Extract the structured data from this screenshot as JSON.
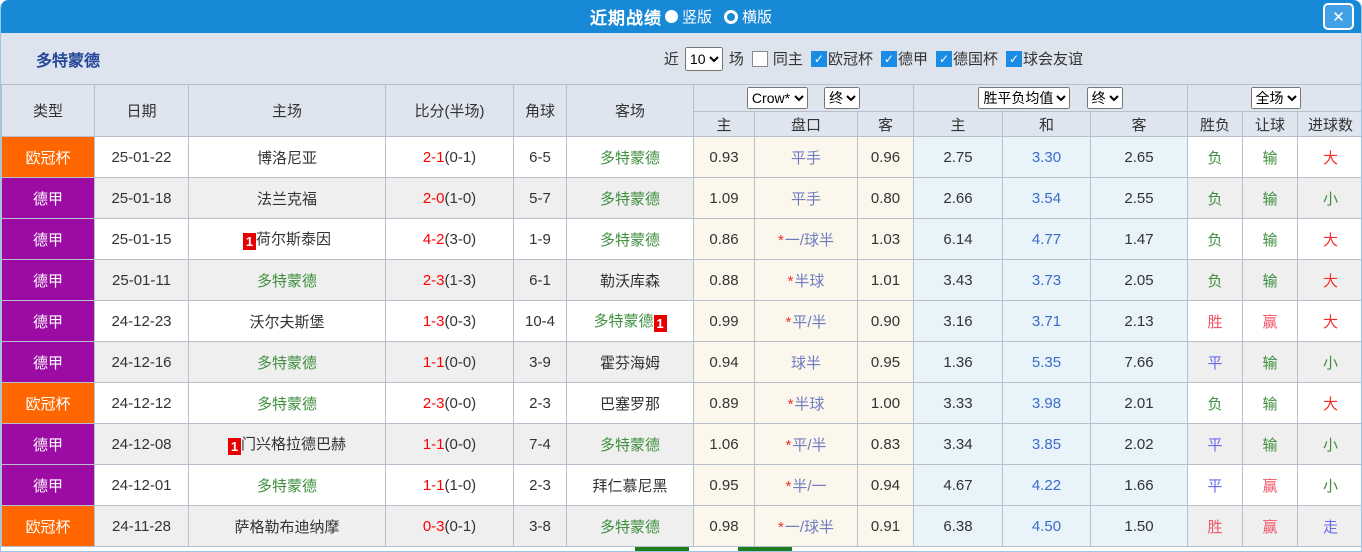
{
  "titlebar": {
    "title": "近期战绩",
    "layout_options": [
      {
        "label": "竖版",
        "selected": true
      },
      {
        "label": "横版",
        "selected": false
      }
    ],
    "close": "✕"
  },
  "filters": {
    "team": "多特蒙德",
    "recent_label": "近",
    "recent_count": "10",
    "matches_label": "场",
    "same_home": {
      "label": "同主",
      "checked": false
    },
    "leagues": [
      {
        "label": "欧冠杯",
        "checked": true
      },
      {
        "label": "德甲",
        "checked": true
      },
      {
        "label": "德国杯",
        "checked": true
      },
      {
        "label": "球会友谊",
        "checked": true
      }
    ]
  },
  "controls": {
    "odds_source": "Crow*",
    "odds_time": "终",
    "wdl_avg": "胜平负均值",
    "wdl_time": "终",
    "scope": "全场"
  },
  "headers": {
    "type": "类型",
    "date": "日期",
    "home": "主场",
    "score": "比分(半场)",
    "corner": "角球",
    "away": "客场",
    "odds_home": "主",
    "handicap": "盘口",
    "odds_away": "客",
    "avg_win": "主",
    "avg_draw": "和",
    "avg_lose": "客",
    "result_wdl": "胜负",
    "result_handicap": "让球",
    "result_goals": "进球数"
  },
  "rows": [
    {
      "type": "欧冠杯",
      "type_color": "orange",
      "date": "25-01-22",
      "home": "博洛尼亚",
      "home_is_target": false,
      "home_badge": "",
      "score": "2-1",
      "half": "(0-1)",
      "corner": "6-5",
      "away": "多特蒙德",
      "away_is_target": true,
      "away_badge": "",
      "odds_home": "0.93",
      "handicap_star": false,
      "handicap": "平手",
      "odds_away": "0.96",
      "avg_win": "2.75",
      "avg_draw": "3.30",
      "avg_lose": "2.65",
      "result_wdl": "负",
      "result_wdl_color": "green",
      "result_handicap": "输",
      "result_handicap_color": "green",
      "result_goals": "大",
      "result_goals_color": "red"
    },
    {
      "type": "德甲",
      "type_color": "purple",
      "date": "25-01-18",
      "home": "法兰克福",
      "home_is_target": false,
      "home_badge": "",
      "score": "2-0",
      "half": "(1-0)",
      "corner": "5-7",
      "away": "多特蒙德",
      "away_is_target": true,
      "away_badge": "",
      "odds_home": "1.09",
      "handicap_star": false,
      "handicap": "平手",
      "odds_away": "0.80",
      "avg_win": "2.66",
      "avg_draw": "3.54",
      "avg_lose": "2.55",
      "result_wdl": "负",
      "result_wdl_color": "green",
      "result_handicap": "输",
      "result_handicap_color": "green",
      "result_goals": "小",
      "result_goals_color": "green"
    },
    {
      "type": "德甲",
      "type_color": "purple",
      "date": "25-01-15",
      "home": "荷尔斯泰因",
      "home_is_target": false,
      "home_badge": "1",
      "score": "4-2",
      "half": "(3-0)",
      "corner": "1-9",
      "away": "多特蒙德",
      "away_is_target": true,
      "away_badge": "",
      "odds_home": "0.86",
      "handicap_star": true,
      "handicap": "一/球半",
      "odds_away": "1.03",
      "avg_win": "6.14",
      "avg_draw": "4.77",
      "avg_lose": "1.47",
      "result_wdl": "负",
      "result_wdl_color": "green",
      "result_handicap": "输",
      "result_handicap_color": "green",
      "result_goals": "大",
      "result_goals_color": "red"
    },
    {
      "type": "德甲",
      "type_color": "purple",
      "date": "25-01-11",
      "home": "多特蒙德",
      "home_is_target": true,
      "home_badge": "",
      "score": "2-3",
      "half": "(1-3)",
      "corner": "6-1",
      "away": "勒沃库森",
      "away_is_target": false,
      "away_badge": "",
      "odds_home": "0.88",
      "handicap_star": true,
      "handicap": "半球",
      "odds_away": "1.01",
      "avg_win": "3.43",
      "avg_draw": "3.73",
      "avg_lose": "2.05",
      "result_wdl": "负",
      "result_wdl_color": "green",
      "result_handicap": "输",
      "result_handicap_color": "green",
      "result_goals": "大",
      "result_goals_color": "red"
    },
    {
      "type": "德甲",
      "type_color": "purple",
      "date": "24-12-23",
      "home": "沃尔夫斯堡",
      "home_is_target": false,
      "home_badge": "",
      "score": "1-3",
      "half": "(0-3)",
      "corner": "10-4",
      "away": "多特蒙德",
      "away_is_target": true,
      "away_badge": "1",
      "odds_home": "0.99",
      "handicap_star": true,
      "handicap": "平/半",
      "odds_away": "0.90",
      "avg_win": "3.16",
      "avg_draw": "3.71",
      "avg_lose": "2.13",
      "result_wdl": "胜",
      "result_wdl_color": "winred",
      "result_handicap": "赢",
      "result_handicap_color": "winred",
      "result_goals": "大",
      "result_goals_color": "red"
    },
    {
      "type": "德甲",
      "type_color": "purple",
      "date": "24-12-16",
      "home": "多特蒙德",
      "home_is_target": true,
      "home_badge": "",
      "score": "1-1",
      "half": "(0-0)",
      "corner": "3-9",
      "away": "霍芬海姆",
      "away_is_target": false,
      "away_badge": "",
      "odds_home": "0.94",
      "handicap_star": false,
      "handicap": "球半",
      "odds_away": "0.95",
      "avg_win": "1.36",
      "avg_draw": "5.35",
      "avg_lose": "7.66",
      "result_wdl": "平",
      "result_wdl_color": "blue",
      "result_handicap": "输",
      "result_handicap_color": "green",
      "result_goals": "小",
      "result_goals_color": "green"
    },
    {
      "type": "欧冠杯",
      "type_color": "orange",
      "date": "24-12-12",
      "home": "多特蒙德",
      "home_is_target": true,
      "home_badge": "",
      "score": "2-3",
      "half": "(0-0)",
      "corner": "2-3",
      "away": "巴塞罗那",
      "away_is_target": false,
      "away_badge": "",
      "odds_home": "0.89",
      "handicap_star": true,
      "handicap": "半球",
      "odds_away": "1.00",
      "avg_win": "3.33",
      "avg_draw": "3.98",
      "avg_lose": "2.01",
      "result_wdl": "负",
      "result_wdl_color": "green",
      "result_handicap": "输",
      "result_handicap_color": "green",
      "result_goals": "大",
      "result_goals_color": "red"
    },
    {
      "type": "德甲",
      "type_color": "purple",
      "date": "24-12-08",
      "home": "门兴格拉德巴赫",
      "home_is_target": false,
      "home_badge": "1",
      "score": "1-1",
      "half": "(0-0)",
      "corner": "7-4",
      "away": "多特蒙德",
      "away_is_target": true,
      "away_badge": "",
      "odds_home": "1.06",
      "handicap_star": true,
      "handicap": "平/半",
      "odds_away": "0.83",
      "avg_win": "3.34",
      "avg_draw": "3.85",
      "avg_lose": "2.02",
      "result_wdl": "平",
      "result_wdl_color": "blue",
      "result_handicap": "输",
      "result_handicap_color": "green",
      "result_goals": "小",
      "result_goals_color": "green"
    },
    {
      "type": "德甲",
      "type_color": "purple",
      "date": "24-12-01",
      "home": "多特蒙德",
      "home_is_target": true,
      "home_badge": "",
      "score": "1-1",
      "half": "(1-0)",
      "corner": "2-3",
      "away": "拜仁慕尼黑",
      "away_is_target": false,
      "away_badge": "",
      "odds_home": "0.95",
      "handicap_star": true,
      "handicap": "半/一",
      "odds_away": "0.94",
      "avg_win": "4.67",
      "avg_draw": "4.22",
      "avg_lose": "1.66",
      "result_wdl": "平",
      "result_wdl_color": "blue",
      "result_handicap": "赢",
      "result_handicap_color": "winred",
      "result_goals": "小",
      "result_goals_color": "green"
    },
    {
      "type": "欧冠杯",
      "type_color": "orange",
      "date": "24-11-28",
      "home": "萨格勒布迪纳摩",
      "home_is_target": false,
      "home_badge": "",
      "score": "0-3",
      "half": "(0-1)",
      "corner": "3-8",
      "away": "多特蒙德",
      "away_is_target": true,
      "away_badge": "",
      "odds_home": "0.98",
      "handicap_star": true,
      "handicap": "一/球半",
      "odds_away": "0.91",
      "avg_win": "6.38",
      "avg_draw": "4.50",
      "avg_lose": "1.50",
      "result_wdl": "胜",
      "result_wdl_color": "winred",
      "result_handicap": "赢",
      "result_handicap_color": "winred",
      "result_goals": "走",
      "result_goals_color": "blue"
    }
  ],
  "colors": {
    "accent_blue": "#1789d6",
    "type_orange": "#ff6600",
    "type_purple": "#9c0ba4",
    "target_team_green": "#3f8f3f",
    "score_red": "#ff0000",
    "draw_odds_blue": "#3a6cc8",
    "handicap_blue": "#6e7cc0",
    "win_red": "#f0556a",
    "lose_green": "#3f8f3f",
    "neutral_blue": "#6a6af0",
    "big_red": "#f12e2e",
    "odds_bg_cream": "#fcf7ec",
    "avg_bg_lightblue": "#e9f3fa"
  }
}
